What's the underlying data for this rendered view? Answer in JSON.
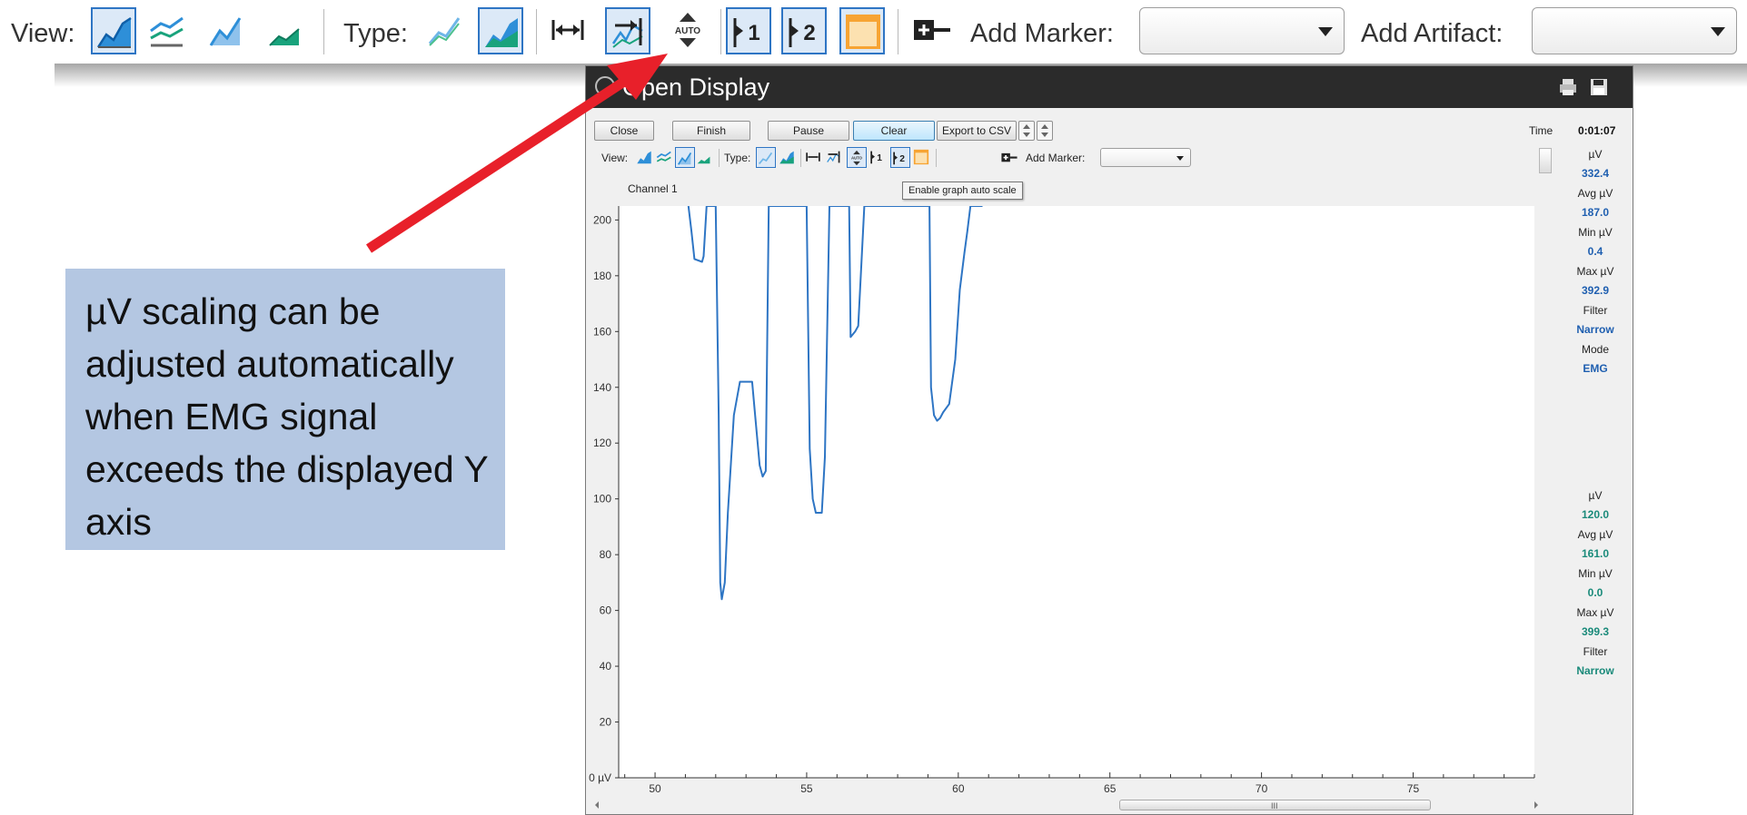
{
  "top_toolbar": {
    "view_label": "View:",
    "type_label": "Type:",
    "add_marker_label": "Add Marker:",
    "add_artifact_label": "Add Artifact:",
    "add_marker_value": "",
    "add_artifact_value": "",
    "auto_icon_text": "AUTO",
    "marker1_text": "1",
    "marker2_text": "2"
  },
  "callout": {
    "text": "µV scaling can be adjusted automatically when EMG signal exceeds the displayed Y axis",
    "background": "#b4c7e2"
  },
  "arrow_color": "#e8202a",
  "window": {
    "title": "Open Display",
    "buttons": {
      "close": "Close",
      "finish": "Finish",
      "pause": "Pause",
      "clear": "Clear",
      "export": "Export to CSV"
    },
    "toolbar": {
      "view_label": "View:",
      "type_label": "Type:",
      "add_marker_label": "Add Marker:",
      "add_marker_value": "",
      "auto_icon_text": "AUTO",
      "marker1_text": "1",
      "marker2_text": "2"
    },
    "tooltip": "Enable graph auto scale",
    "channel_label": "Channel 1",
    "time_label": "Time",
    "time_value": "0:01:07",
    "stats_channel1": [
      {
        "label": "µV",
        "value": "332.4"
      },
      {
        "label": "Avg µV",
        "value": "187.0"
      },
      {
        "label": "Min µV",
        "value": "0.4"
      },
      {
        "label": "Max µV",
        "value": "392.9"
      },
      {
        "label": "Filter",
        "value": "Narrow"
      },
      {
        "label": "Mode",
        "value": "EMG"
      }
    ],
    "stats_channel2": [
      {
        "label": "µV",
        "value": "120.0"
      },
      {
        "label": "Avg µV",
        "value": "161.0"
      },
      {
        "label": "Min µV",
        "value": "0.0"
      },
      {
        "label": "Max µV",
        "value": "399.3"
      },
      {
        "label": "Filter",
        "value": "Narrow"
      }
    ],
    "stat_colors": {
      "channel1": "#1f5fb0",
      "channel2": "#1a8a7a"
    },
    "scroll_grip": "III"
  },
  "chart_data": {
    "type": "line",
    "title": "Channel 1",
    "xlabel": "",
    "ylabel": "",
    "y_unit": "µV",
    "xlim": [
      48.8,
      79
    ],
    "ylim": [
      0,
      205
    ],
    "x_ticks": [
      50,
      55,
      60,
      65,
      70,
      75
    ],
    "y_ticks": [
      0,
      20,
      40,
      60,
      80,
      100,
      120,
      140,
      160,
      180,
      200
    ],
    "y_tick_labels": [
      "0 µV",
      "20",
      "40",
      "60",
      "80",
      "100",
      "120",
      "140",
      "160",
      "180",
      "200"
    ],
    "grid": false,
    "line_color": "#2e75c4",
    "series": [
      {
        "x": [
          51.1,
          51.2,
          51.3,
          51.55,
          51.6,
          51.7,
          51.8,
          52.0,
          52.1,
          52.15,
          52.2,
          52.3,
          52.4,
          52.6,
          52.8,
          53.0,
          53.1,
          53.2,
          53.3,
          53.45,
          53.55,
          53.65,
          53.75,
          53.9,
          54.0,
          54.1,
          54.2,
          54.5,
          54.6,
          54.8,
          55.0,
          55.1,
          55.2,
          55.3,
          55.5,
          55.6,
          55.75,
          56.0,
          56.1,
          56.2,
          56.4,
          56.45,
          56.6,
          56.7,
          56.9,
          57.05,
          57.4,
          57.8,
          58.2,
          58.6,
          59.0,
          59.05,
          59.1,
          59.2,
          59.3,
          59.4,
          59.5,
          59.7,
          59.9,
          60.05,
          60.2,
          60.3,
          60.4,
          60.5,
          60.6,
          60.7,
          60.8
        ],
        "y": [
          205,
          196,
          186,
          185,
          187,
          205,
          205,
          205,
          130,
          70,
          64,
          70,
          95,
          130,
          142,
          142,
          142,
          142,
          130,
          112,
          108,
          110,
          205,
          205,
          205,
          205,
          205,
          205,
          205,
          205,
          205,
          118,
          100,
          95,
          95,
          115,
          205,
          205,
          205,
          205,
          205,
          158,
          160,
          162,
          205,
          205,
          205,
          205,
          205,
          205,
          205,
          205,
          140,
          130,
          128,
          129,
          131,
          134,
          150,
          175,
          188,
          196,
          205,
          205,
          205,
          205,
          205
        ]
      }
    ]
  }
}
